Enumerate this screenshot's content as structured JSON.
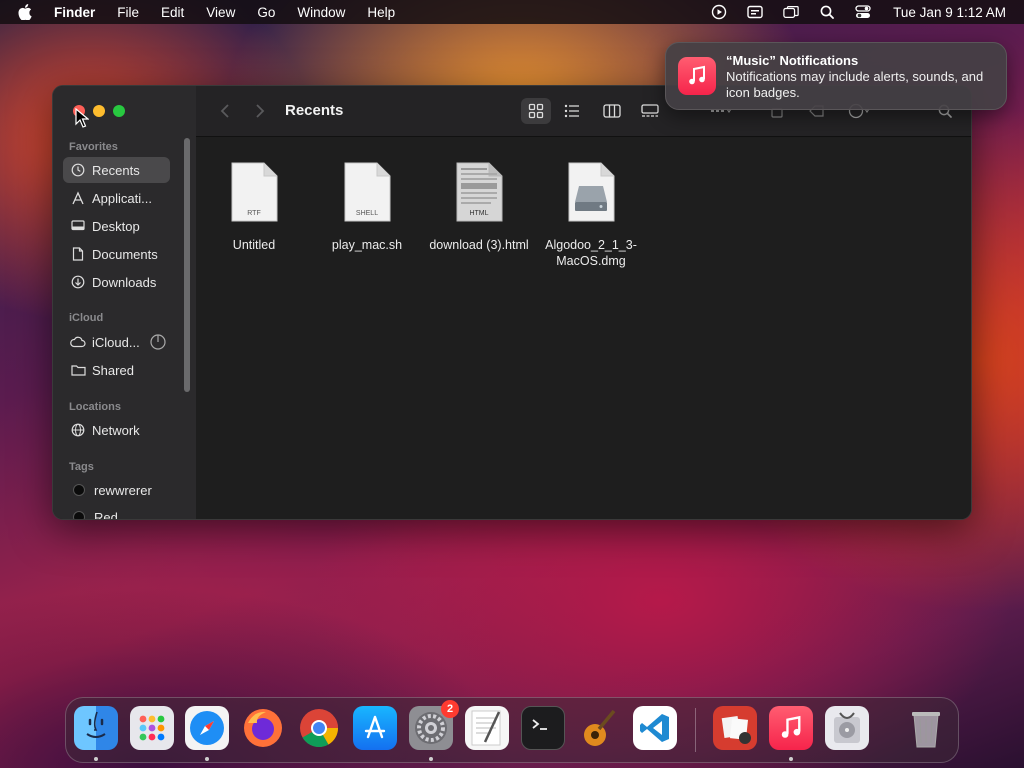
{
  "menubar": {
    "app": "Finder",
    "items": [
      "File",
      "Edit",
      "View",
      "Go",
      "Window",
      "Help"
    ],
    "clock": "Tue Jan 9  1:12 AM",
    "status_icons": [
      "screen-record-icon",
      "keyboard-input-icon",
      "screen-mirroring-icon",
      "search-icon",
      "control-center-icon"
    ]
  },
  "notification": {
    "title": "“Music” Notifications",
    "body": "Notifications may include alerts, sounds, and icon badges.",
    "app_icon": "music-note-icon"
  },
  "finder": {
    "title": "Recents",
    "sidebar": {
      "favorites_label": "Favorites",
      "favorites": [
        {
          "label": "Recents",
          "icon": "clock-icon",
          "active": true
        },
        {
          "label": "Applicati...",
          "icon": "applications-icon"
        },
        {
          "label": "Desktop",
          "icon": "desktop-icon"
        },
        {
          "label": "Documents",
          "icon": "document-icon"
        },
        {
          "label": "Downloads",
          "icon": "downloads-icon"
        }
      ],
      "icloud_label": "iCloud",
      "icloud": [
        {
          "label": "iCloud...",
          "icon": "cloud-icon"
        },
        {
          "label": "Shared",
          "icon": "shared-folder-icon"
        }
      ],
      "locations_label": "Locations",
      "locations": [
        {
          "label": "Network",
          "icon": "globe-icon"
        }
      ],
      "tags_label": "Tags",
      "tags": [
        {
          "label": "rewwrerer",
          "color": "#000000"
        },
        {
          "label": "Red",
          "color": "#000000"
        }
      ]
    },
    "files": [
      {
        "name": "Untitled",
        "badge": "RTF"
      },
      {
        "name": "play_mac.sh",
        "badge": "SHELL"
      },
      {
        "name": "download (3).html",
        "badge": "HTML"
      },
      {
        "name": "Algodoo_2_1_3-MacOS.dmg",
        "badge": ""
      }
    ]
  },
  "dock": {
    "apps": [
      "Finder",
      "Launchpad",
      "Safari",
      "Firefox",
      "Chrome",
      "App Store",
      "System Settings",
      "TextEdit",
      "Terminal",
      "GarageBand",
      "Visual Studio Code",
      "Photo Booth",
      "Music",
      "Disk Utility",
      "Trash"
    ],
    "settings_badge": "2"
  }
}
